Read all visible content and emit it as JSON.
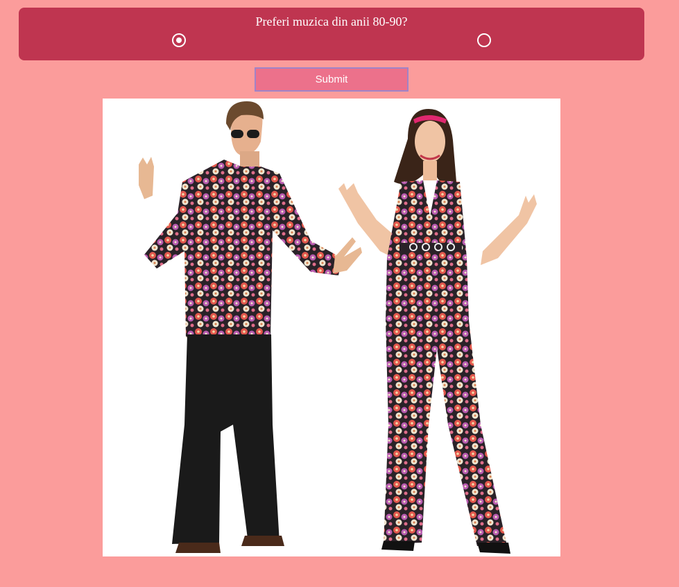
{
  "poll": {
    "question": "Preferi muzica din anii 80-90?",
    "options": [
      {
        "selected": true
      },
      {
        "selected": false
      }
    ]
  },
  "submit": {
    "label": "Submit"
  },
  "image": {
    "description": "couple in 70s disco outfits making peace signs"
  },
  "colors": {
    "background": "#fb9c9b",
    "panel": "#bf3550",
    "button": "#ec718b",
    "button_border": "#a084c8"
  }
}
